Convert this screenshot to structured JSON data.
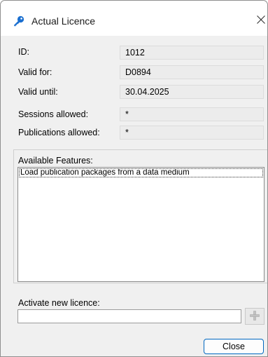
{
  "window": {
    "title": "Actual Licence",
    "title_icon": "key-icon",
    "close_icon": "close-icon"
  },
  "fields": [
    {
      "label": "ID:",
      "value": "1012"
    },
    {
      "label": "Valid for:",
      "value": "D0894"
    },
    {
      "label": "Valid until:",
      "value": "30.04.2025"
    },
    {
      "label": "Sessions allowed:",
      "value": "*"
    },
    {
      "label": "Publications allowed:",
      "value": "*"
    }
  ],
  "features": {
    "label": "Available Features:",
    "items": [
      "Load publication packages from a data medium"
    ]
  },
  "activation": {
    "label": "Activate new licence:",
    "value": "",
    "add_icon": "plus-icon"
  },
  "buttons": {
    "close_label": "Close"
  },
  "colors": {
    "accent": "#0067c0",
    "key_icon": "#1a6fd0",
    "dialog_bg": "#f0f0f0",
    "readonly_field_bg": "#ececec"
  }
}
